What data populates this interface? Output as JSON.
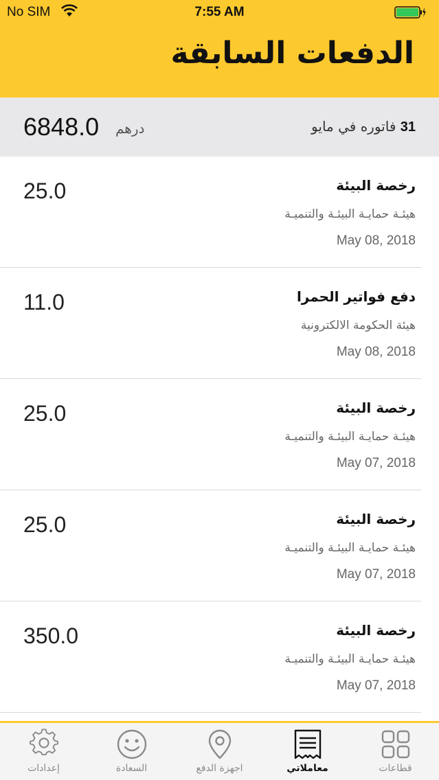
{
  "status_bar": {
    "carrier": "No SIM",
    "time": "7:55 AM"
  },
  "header": {
    "title": "الدفعات السابقة"
  },
  "summary": {
    "count": "31",
    "text": "فاتوره في  مايو",
    "amount": "6848.0",
    "currency": "درهم"
  },
  "payments": [
    {
      "title": "رخصة البيئة",
      "authority": "هيئـة حمايـة البيئـة والتنميـة",
      "date": "May 08, 2018",
      "amount": "25.0"
    },
    {
      "title": "دفع فواتير الحمرا",
      "authority": "هيئة الحكومة الالكترونية",
      "date": "May 08, 2018",
      "amount": "11.0"
    },
    {
      "title": "رخصة البيئة",
      "authority": "هيئـة حمايـة البيئـة والتنميـة",
      "date": "May 07, 2018",
      "amount": "25.0"
    },
    {
      "title": "رخصة البيئة",
      "authority": "هيئـة حمايـة البيئـة والتنميـة",
      "date": "May 07, 2018",
      "amount": "25.0"
    },
    {
      "title": "رخصة البيئة",
      "authority": "هيئـة حمايـة البيئـة والتنميـة",
      "date": "May 07, 2018",
      "amount": "350.0"
    }
  ],
  "tabs": [
    {
      "label": "إعدادات",
      "icon": "gear-icon"
    },
    {
      "label": "السعادة",
      "icon": "smiley-icon"
    },
    {
      "label": "اجهزة الدفع",
      "icon": "location-pin-icon"
    },
    {
      "label": "معاملاتي",
      "icon": "receipt-icon",
      "active": true
    },
    {
      "label": "قطاعات",
      "icon": "grid-icon"
    }
  ],
  "colors": {
    "accent": "#fcc92e",
    "summary_bg": "#e8e8ea",
    "tab_inactive": "#8a8a8a"
  }
}
